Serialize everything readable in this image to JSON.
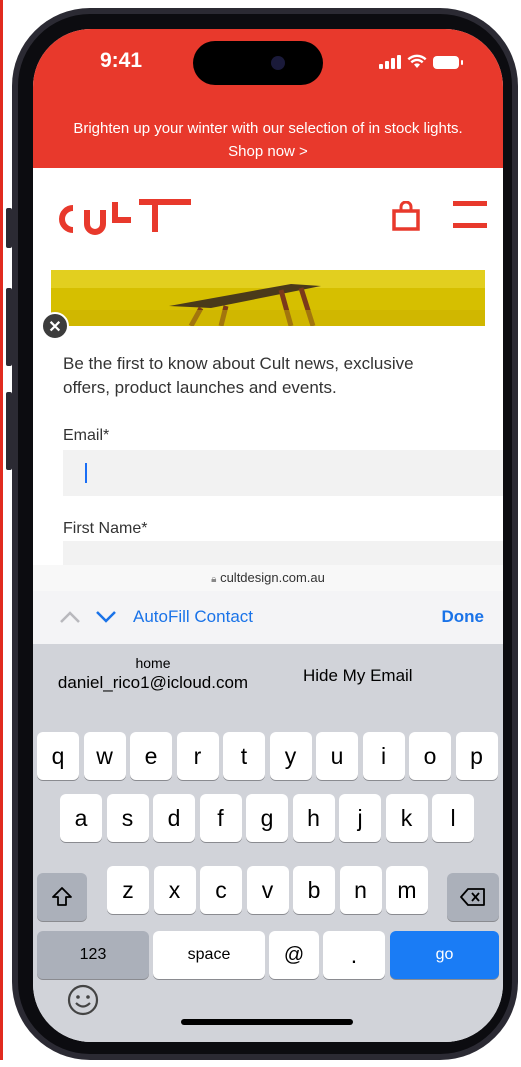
{
  "status_bar": {
    "time": "9:41"
  },
  "banner": {
    "text": "Brighten up your winter with our selection of in stock lights. Shop now >"
  },
  "header": {
    "logo_text": "CULT"
  },
  "form": {
    "intro": "Be the first to know about Cult news, exclusive offers, product launches and events.",
    "email_label": "Email*",
    "email_value": "",
    "first_name_label": "First Name*",
    "first_name_value": ""
  },
  "browser": {
    "url": "cultdesign.com.au"
  },
  "toolbar": {
    "autofill_label": "AutoFill Contact",
    "done_label": "Done"
  },
  "suggestions": {
    "left_caption": "home",
    "left_value": "daniel_rico1@icloud.com",
    "right": "Hide My Email"
  },
  "keyboard": {
    "row1": [
      "q",
      "w",
      "e",
      "r",
      "t",
      "y",
      "u",
      "i",
      "o",
      "p"
    ],
    "row2": [
      "a",
      "s",
      "d",
      "f",
      "g",
      "h",
      "j",
      "k",
      "l"
    ],
    "row3": [
      "z",
      "x",
      "c",
      "v",
      "b",
      "n",
      "m"
    ],
    "numbers_label": "123",
    "space_label": "space",
    "at_label": "@",
    "dot_label": ".",
    "go_label": "go"
  },
  "colors": {
    "brand": "#e8392c",
    "accent": "#1a73e8",
    "go_key": "#1a7cf5",
    "keyboard_bg": "#d1d3d9"
  }
}
